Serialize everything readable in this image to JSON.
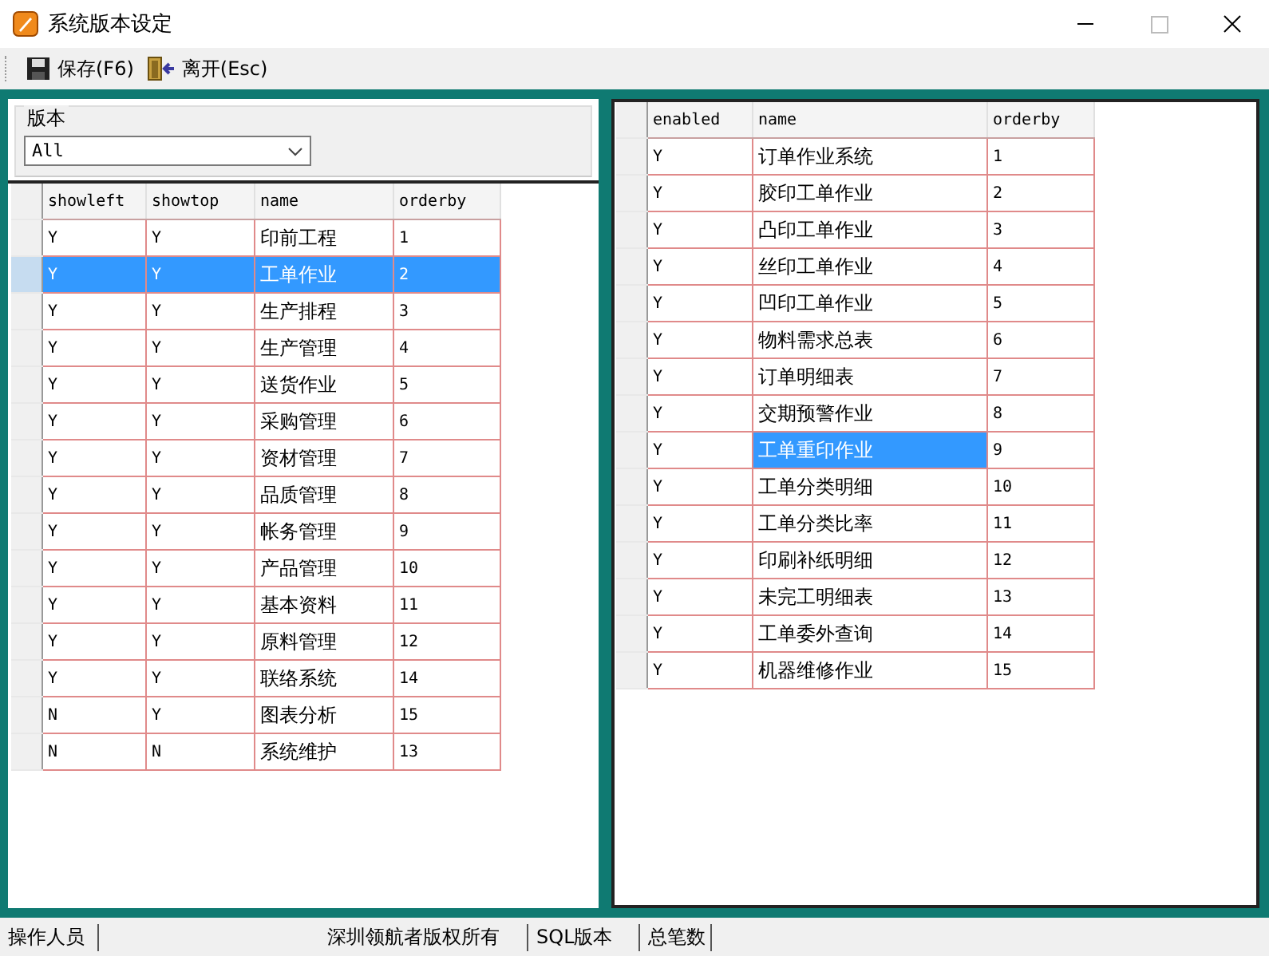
{
  "window": {
    "title": "系统版本设定"
  },
  "toolbar": [
    {
      "kind": "save",
      "label": "保存(F6)"
    },
    {
      "kind": "exit",
      "label": "离开(Esc)"
    }
  ],
  "version_group": {
    "label": "版本",
    "value": "All"
  },
  "left_table": {
    "columns": [
      "showleft",
      "showtop",
      "name",
      "orderby"
    ],
    "rows": [
      {
        "cells": [
          "Y",
          "Y",
          "印前工程",
          "1"
        ],
        "selected": false
      },
      {
        "cells": [
          "Y",
          "Y",
          "工单作业",
          "2"
        ],
        "selected": true
      },
      {
        "cells": [
          "Y",
          "Y",
          "生产排程",
          "3"
        ],
        "selected": false
      },
      {
        "cells": [
          "Y",
          "Y",
          "生产管理",
          "4"
        ],
        "selected": false
      },
      {
        "cells": [
          "Y",
          "Y",
          "送货作业",
          "5"
        ],
        "selected": false
      },
      {
        "cells": [
          "Y",
          "Y",
          "采购管理",
          "6"
        ],
        "selected": false
      },
      {
        "cells": [
          "Y",
          "Y",
          "资材管理",
          "7"
        ],
        "selected": false
      },
      {
        "cells": [
          "Y",
          "Y",
          "品质管理",
          "8"
        ],
        "selected": false
      },
      {
        "cells": [
          "Y",
          "Y",
          "帐务管理",
          "9"
        ],
        "selected": false
      },
      {
        "cells": [
          "Y",
          "Y",
          "产品管理",
          "10"
        ],
        "selected": false
      },
      {
        "cells": [
          "Y",
          "Y",
          "基本资料",
          "11"
        ],
        "selected": false
      },
      {
        "cells": [
          "Y",
          "Y",
          "原料管理",
          "12"
        ],
        "selected": false
      },
      {
        "cells": [
          "Y",
          "Y",
          "联络系统",
          "14"
        ],
        "selected": false
      },
      {
        "cells": [
          "N",
          "Y",
          "图表分析",
          "15"
        ],
        "selected": false
      },
      {
        "cells": [
          "N",
          "N",
          "系统维护",
          "13"
        ],
        "selected": false
      }
    ]
  },
  "right_table": {
    "columns": [
      "enabled",
      "name",
      "orderby"
    ],
    "rows": [
      {
        "cells": [
          "Y",
          "订单作业系统",
          "1"
        ],
        "selected": false
      },
      {
        "cells": [
          "Y",
          "胶印工单作业",
          "2"
        ],
        "selected": false
      },
      {
        "cells": [
          "Y",
          "凸印工单作业",
          "3"
        ],
        "selected": false
      },
      {
        "cells": [
          "Y",
          "丝印工单作业",
          "4"
        ],
        "selected": false
      },
      {
        "cells": [
          "Y",
          "凹印工单作业",
          "5"
        ],
        "selected": false
      },
      {
        "cells": [
          "Y",
          "物料需求总表",
          "6"
        ],
        "selected": false
      },
      {
        "cells": [
          "Y",
          "订单明细表",
          "7"
        ],
        "selected": false
      },
      {
        "cells": [
          "Y",
          "交期预警作业",
          "8"
        ],
        "selected": false
      },
      {
        "cells": [
          "Y",
          "工单重印作业",
          "9"
        ],
        "selected": true
      },
      {
        "cells": [
          "Y",
          "工单分类明细",
          "10"
        ],
        "selected": false
      },
      {
        "cells": [
          "Y",
          "工单分类比率",
          "11"
        ],
        "selected": false
      },
      {
        "cells": [
          "Y",
          "印刷补纸明细",
          "12"
        ],
        "selected": false
      },
      {
        "cells": [
          "Y",
          "未完工明细表",
          "13"
        ],
        "selected": false
      },
      {
        "cells": [
          "Y",
          "工单委外查询",
          "14"
        ],
        "selected": false
      },
      {
        "cells": [
          "Y",
          "机器维修作业",
          "15"
        ],
        "selected": false
      }
    ]
  },
  "status_bar": [
    "操作人员",
    "深圳领航者版权所有",
    "SQL版本",
    "总笔数"
  ]
}
